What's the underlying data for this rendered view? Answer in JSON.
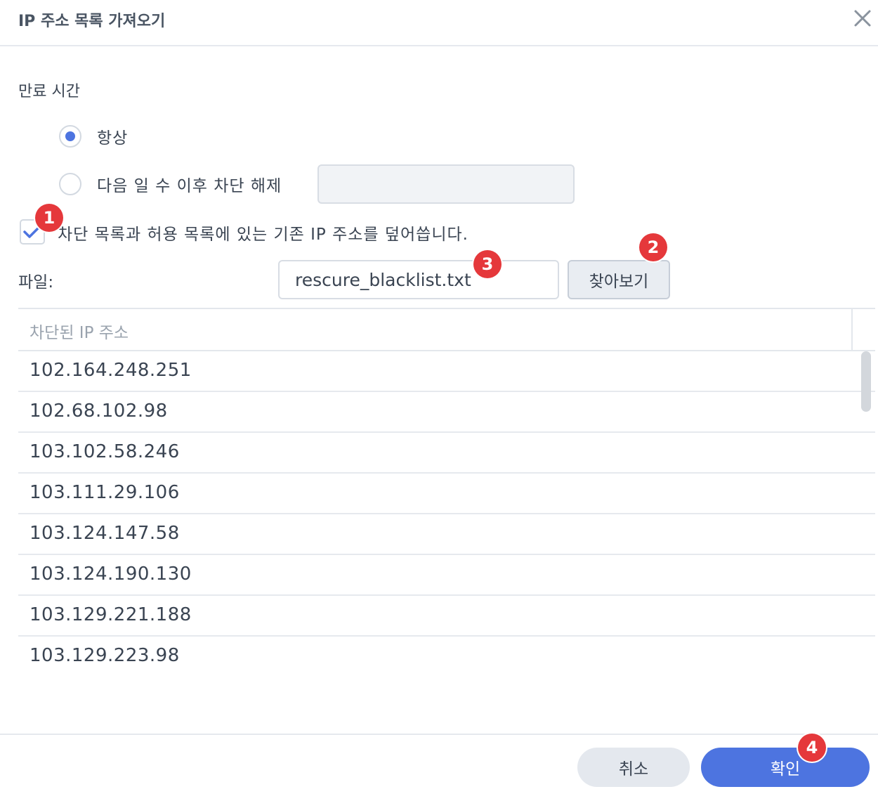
{
  "dialog": {
    "title": "IP 주소 목록 가져오기",
    "close_icon": "close-icon"
  },
  "expiry": {
    "label": "만료 시간",
    "options": [
      {
        "label": "항상",
        "checked": true
      },
      {
        "label": "다음 일 수 이후 차단 해제",
        "checked": false
      }
    ],
    "days_value": ""
  },
  "overwrite": {
    "label": "차단 목록과 허용 목록에 있는 기존 IP 주소를 덮어씁니다.",
    "checked": true
  },
  "file": {
    "label": "파일:",
    "value": "rescure_blacklist.txt",
    "browse_label": "찾아보기"
  },
  "table": {
    "header": "차단된 IP 주소",
    "rows": [
      "102.164.248.251",
      "102.68.102.98",
      "103.102.58.246",
      "103.111.29.106",
      "103.124.147.58",
      "103.124.190.130",
      "103.129.221.188",
      "103.129.223.98"
    ]
  },
  "footer": {
    "cancel_label": "취소",
    "ok_label": "확인"
  },
  "badges": [
    "1",
    "2",
    "3",
    "4"
  ],
  "colors": {
    "accent": "#4d74e0",
    "badge": "#e5383b"
  }
}
